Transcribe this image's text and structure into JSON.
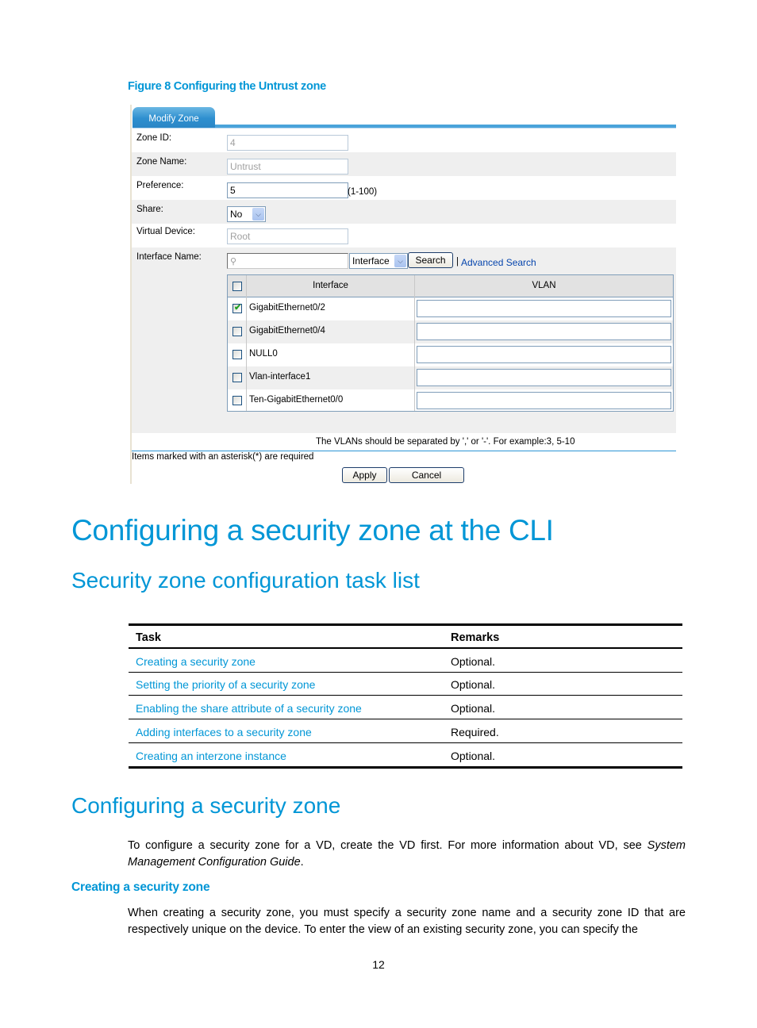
{
  "figure": {
    "caption": "Figure 8 Configuring the Untrust zone",
    "tab_label": "Modify Zone",
    "fields": {
      "zone_id": {
        "label": "Zone ID:",
        "value": "4"
      },
      "zone_name": {
        "label": "Zone Name:",
        "value": "Untrust"
      },
      "preference": {
        "label": "Preference:",
        "value": "5",
        "hint": "(1-100)"
      },
      "share": {
        "label": "Share:",
        "value": "No"
      },
      "virtual_device": {
        "label": "Virtual Device:",
        "value": "Root"
      },
      "interface_name": {
        "label": "Interface Name:",
        "search_value": "",
        "filter_value": "Interface"
      }
    },
    "search_button": "Search",
    "separator": "|",
    "advanced_search": "Advanced Search",
    "interface_table": {
      "headers": {
        "interface": "Interface",
        "vlan": "VLAN"
      },
      "rows": [
        {
          "interface": "GigabitEthernet0/2",
          "checked": true,
          "vlan": ""
        },
        {
          "interface": "GigabitEthernet0/4",
          "checked": false,
          "vlan": ""
        },
        {
          "interface": "NULL0",
          "checked": false,
          "vlan": ""
        },
        {
          "interface": "Vlan-interface1",
          "checked": false,
          "vlan": ""
        },
        {
          "interface": "Ten-GigabitEthernet0/0",
          "checked": false,
          "vlan": ""
        }
      ]
    },
    "vlan_note": "The VLANs should be separated by ',' or '-'. For example:3, 5-10",
    "required_note": "Items marked with an asterisk(*) are required",
    "apply_button": "Apply",
    "cancel_button": "Cancel"
  },
  "document": {
    "heading1": "Configuring a security zone at the CLI",
    "heading2_tasklist": "Security zone configuration task list",
    "task_table": {
      "headers": {
        "task": "Task",
        "remarks": "Remarks"
      },
      "rows": [
        {
          "task": "Creating a security zone",
          "remarks": "Optional."
        },
        {
          "task": "Setting the priority of a security zone",
          "remarks": "Optional."
        },
        {
          "task": "Enabling the share attribute of a security zone",
          "remarks": "Optional."
        },
        {
          "task": "Adding interfaces to a security zone",
          "remarks": "Required."
        },
        {
          "task": "Creating an interzone instance",
          "remarks": "Optional."
        }
      ]
    },
    "heading2_config": "Configuring a security zone",
    "intro_para": {
      "text": "To configure a security zone for a VD, create the VD first. For more information about VD, see ",
      "italic": "System Management Configuration Guide",
      "end": "."
    },
    "heading3": "Creating a security zone",
    "body_para": "When creating a security zone, you must specify a security zone name and a security zone ID that are respectively unique on the device. To enter the view of an existing security zone, you can specify the",
    "page_number": "12"
  }
}
